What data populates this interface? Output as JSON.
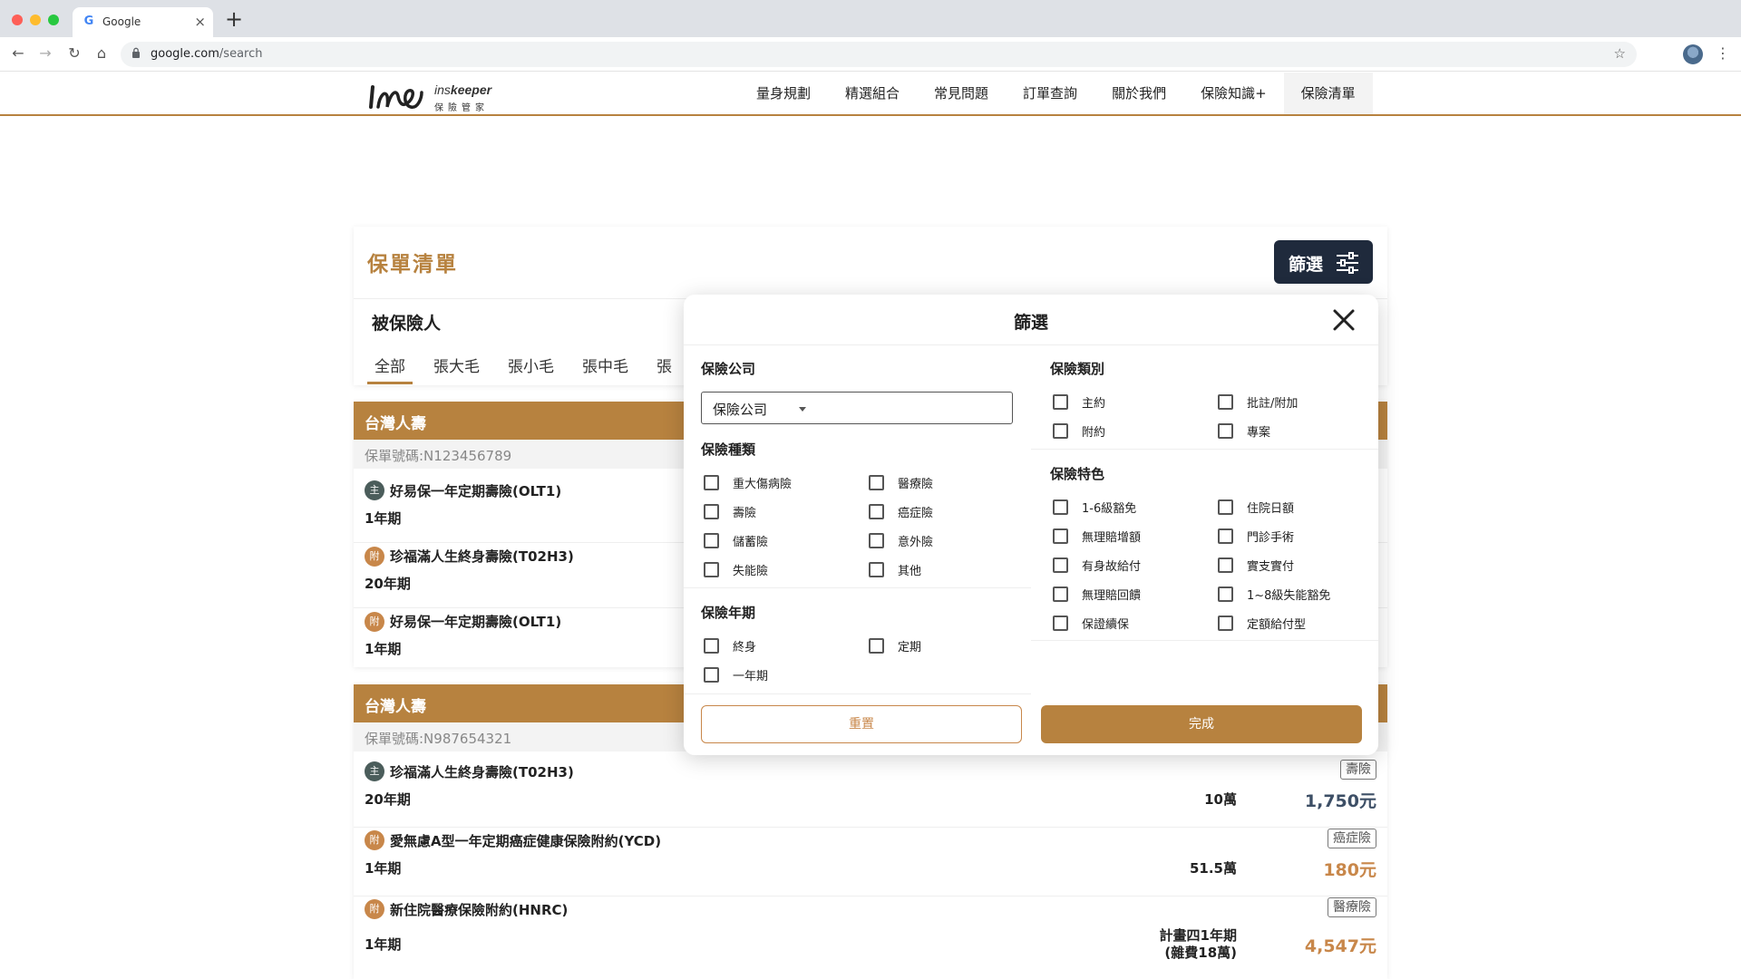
{
  "browser": {
    "tab_title": "Google",
    "tab_close": "×",
    "new_tab": "+",
    "url_host": "google.com",
    "url_path": "/search"
  },
  "header": {
    "logo_brand_light": "ins",
    "logo_brand_bold": "keeper",
    "logo_subtitle": "保險管家",
    "nav": [
      "量身規劃",
      "精選組合",
      "常見問題",
      "訂單查詢",
      "關於我們",
      "保險知識+",
      "保險清單"
    ],
    "active_nav": "保險清單"
  },
  "list": {
    "title": "保單清單",
    "filter_button": "篩選",
    "insured_label": "被保險人",
    "persons": [
      "全部",
      "張大毛",
      "張小毛",
      "張中毛",
      "張"
    ],
    "active_person": "全部"
  },
  "policies": [
    {
      "company": "台灣人壽",
      "policy_no": "保單號碼:N123456789",
      "items": [
        {
          "badge": "主",
          "kind": "main",
          "name": "好易保一年定期壽險(OLT1)",
          "term": "1年期"
        },
        {
          "badge": "附",
          "kind": "rider",
          "name": "珍福滿人生終身壽險(T02H3)",
          "term": "20年期"
        },
        {
          "badge": "附",
          "kind": "rider",
          "name": "好易保一年定期壽險(OLT1)",
          "term": "1年期"
        }
      ]
    },
    {
      "company": "台灣人壽",
      "policy_no": "保單號碼:N987654321",
      "items": [
        {
          "badge": "主",
          "kind": "main",
          "name": "珍福滿人生終身壽險(T02H3)",
          "term": "20年期",
          "amount": "10萬",
          "type": "壽險",
          "price": "1,750元",
          "price_color": "#3d4f66"
        },
        {
          "badge": "附",
          "kind": "rider",
          "name": "愛無慮A型一年定期癌症健康保險附約(YCD)",
          "term": "1年期",
          "amount": "51.5萬",
          "type": "癌症險",
          "price": "180元",
          "price_color": "#c8874a"
        },
        {
          "badge": "附",
          "kind": "rider",
          "name": "新住院醫療保險附約(HNRC)",
          "term": "1年期",
          "amount_line1": "計畫四1年期",
          "amount_line2": "(雜費18萬)",
          "type": "醫療險",
          "price": "4,547元",
          "price_color": "#c8874a"
        }
      ]
    }
  ],
  "filter": {
    "title": "篩選",
    "company_section": "保險公司",
    "company_select_value": "保險公司",
    "type_section": "保險種類",
    "types": [
      "重大傷病險",
      "醫療險",
      "壽險",
      "癌症險",
      "儲蓄險",
      "意外險",
      "失能險",
      "其他"
    ],
    "period_section": "保險年期",
    "periods": [
      "終身",
      "定期",
      "一年期"
    ],
    "category_section": "保險類別",
    "categories": [
      "主約",
      "批註/附加",
      "附約",
      "專案"
    ],
    "feature_section": "保險特色",
    "features": [
      "1-6級豁免",
      "住院日額",
      "無理賠增額",
      "門診手術",
      "有身故給付",
      "實支實付",
      "無理賠回饋",
      "1~8級失能豁免",
      "保證續保",
      "定額給付型"
    ],
    "reset_button": "重置",
    "done_button": "完成"
  },
  "colors": {
    "accent": "#b7823f",
    "dark_button": "#1f2a3c",
    "main_badge": "#4b5d5b",
    "rider_badge": "#c8874a"
  }
}
